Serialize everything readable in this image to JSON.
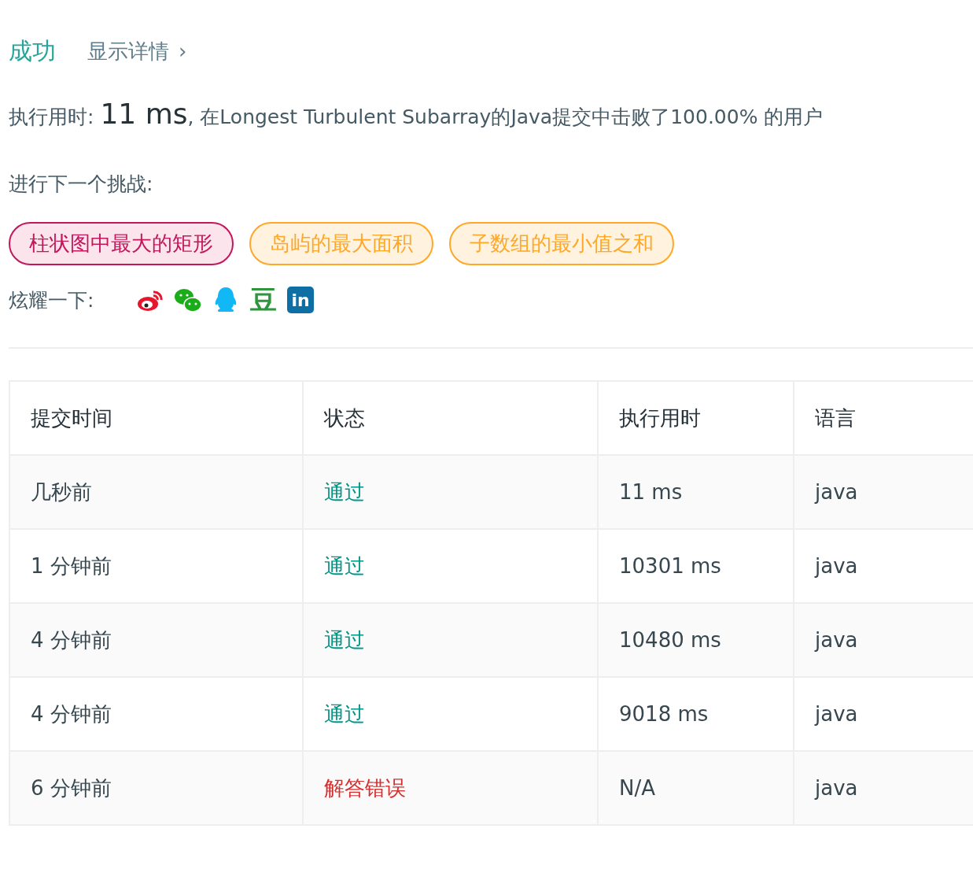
{
  "header": {
    "status": "成功",
    "details_link": "显示详情",
    "chevron": "›"
  },
  "summary": {
    "label": "执行用时:",
    "runtime": "11 ms",
    "rest": ", 在Longest Turbulent Subarray的Java提交中击败了100.00% 的用户"
  },
  "next_challenge": {
    "label": "进行下一个挑战:",
    "tags": [
      {
        "text": "柱状图中最大的矩形",
        "kind": "hard"
      },
      {
        "text": "岛屿的最大面积",
        "kind": "medium"
      },
      {
        "text": "子数组的最小值之和",
        "kind": "medium"
      }
    ]
  },
  "share": {
    "label": "炫耀一下:",
    "icons": [
      {
        "kind": "weibo"
      },
      {
        "kind": "wechat"
      },
      {
        "kind": "qq"
      },
      {
        "kind": "douban",
        "glyph": "豆"
      },
      {
        "kind": "linkedin",
        "glyph": "in"
      }
    ]
  },
  "table": {
    "columns": [
      "提交时间",
      "状态",
      "执行用时",
      "语言"
    ],
    "rows": [
      {
        "time": "几秒前",
        "status": "通过",
        "kind": "accepted",
        "runtime": "11 ms",
        "language": "java"
      },
      {
        "time": "1 分钟前",
        "status": "通过",
        "kind": "accepted",
        "runtime": "10301 ms",
        "language": "java"
      },
      {
        "time": "4 分钟前",
        "status": "通过",
        "kind": "accepted",
        "runtime": "10480 ms",
        "language": "java"
      },
      {
        "time": "4 分钟前",
        "status": "通过",
        "kind": "accepted",
        "runtime": "9018 ms",
        "language": "java"
      },
      {
        "time": "6 分钟前",
        "status": "解答错误",
        "kind": "wrong",
        "runtime": "N/A",
        "language": "java"
      }
    ]
  }
}
